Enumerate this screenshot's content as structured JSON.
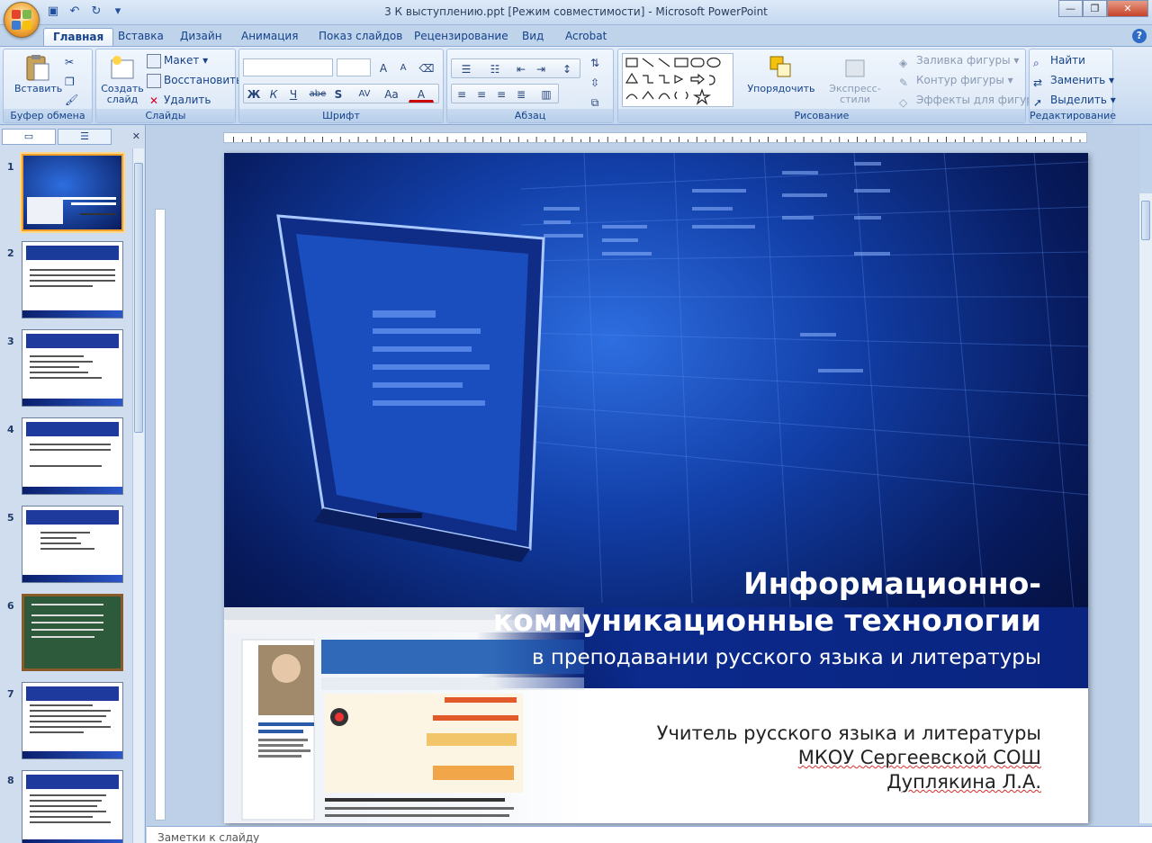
{
  "window": {
    "title": "3 К выступлению.ppt [Режим совместимости] - Microsoft PowerPoint",
    "controls": {
      "minimize": "—",
      "maximize": "❐",
      "close": "✕"
    }
  },
  "tabs": [
    "Главная",
    "Вставка",
    "Дизайн",
    "Анимация",
    "Показ слайдов",
    "Рецензирование",
    "Вид",
    "Acrobat"
  ],
  "ribbon": {
    "clipboard": {
      "label": "Буфер обмена",
      "paste": "Вставить"
    },
    "slides": {
      "label": "Слайды",
      "new_slide": "Создать слайд",
      "layout": "Макет",
      "reset": "Восстановить",
      "delete": "Удалить"
    },
    "font": {
      "label": "Шрифт",
      "bold": "Ж",
      "italic": "К",
      "underline": "Ч",
      "strike": "abe",
      "shadow": "S",
      "spacing": "AV",
      "case": "Aa",
      "color": "A",
      "grow": "A",
      "shrink": "A"
    },
    "paragraph": {
      "label": "Абзац"
    },
    "drawing": {
      "label": "Рисование",
      "arrange": "Упорядочить",
      "quick_styles": "Экспресс-стили",
      "fill": "Заливка фигуры",
      "outline": "Контур фигуры",
      "effects": "Эффекты для фигур"
    },
    "editing": {
      "label": "Редактирование",
      "find": "Найти",
      "replace": "Заменить",
      "select": "Выделить"
    }
  },
  "slides_pane": {
    "numbers": [
      "1",
      "2",
      "3",
      "4",
      "5",
      "6",
      "7",
      "8"
    ]
  },
  "slide": {
    "title_line1": "Информационно-",
    "title_line2": "коммуникационные технологии",
    "subtitle": "в преподавании русского языка и литературы",
    "author_line1": "Учитель русского языка и литературы",
    "author_line2": "МКОУ Сергеевской СОШ",
    "author_line3": "Дуплякина Л.А."
  },
  "notes": {
    "placeholder": "Заметки к слайду"
  },
  "colors": {
    "ribbon_text": "#15428b",
    "slide_bg": "#071a5c",
    "selection": "#f2a02a"
  }
}
